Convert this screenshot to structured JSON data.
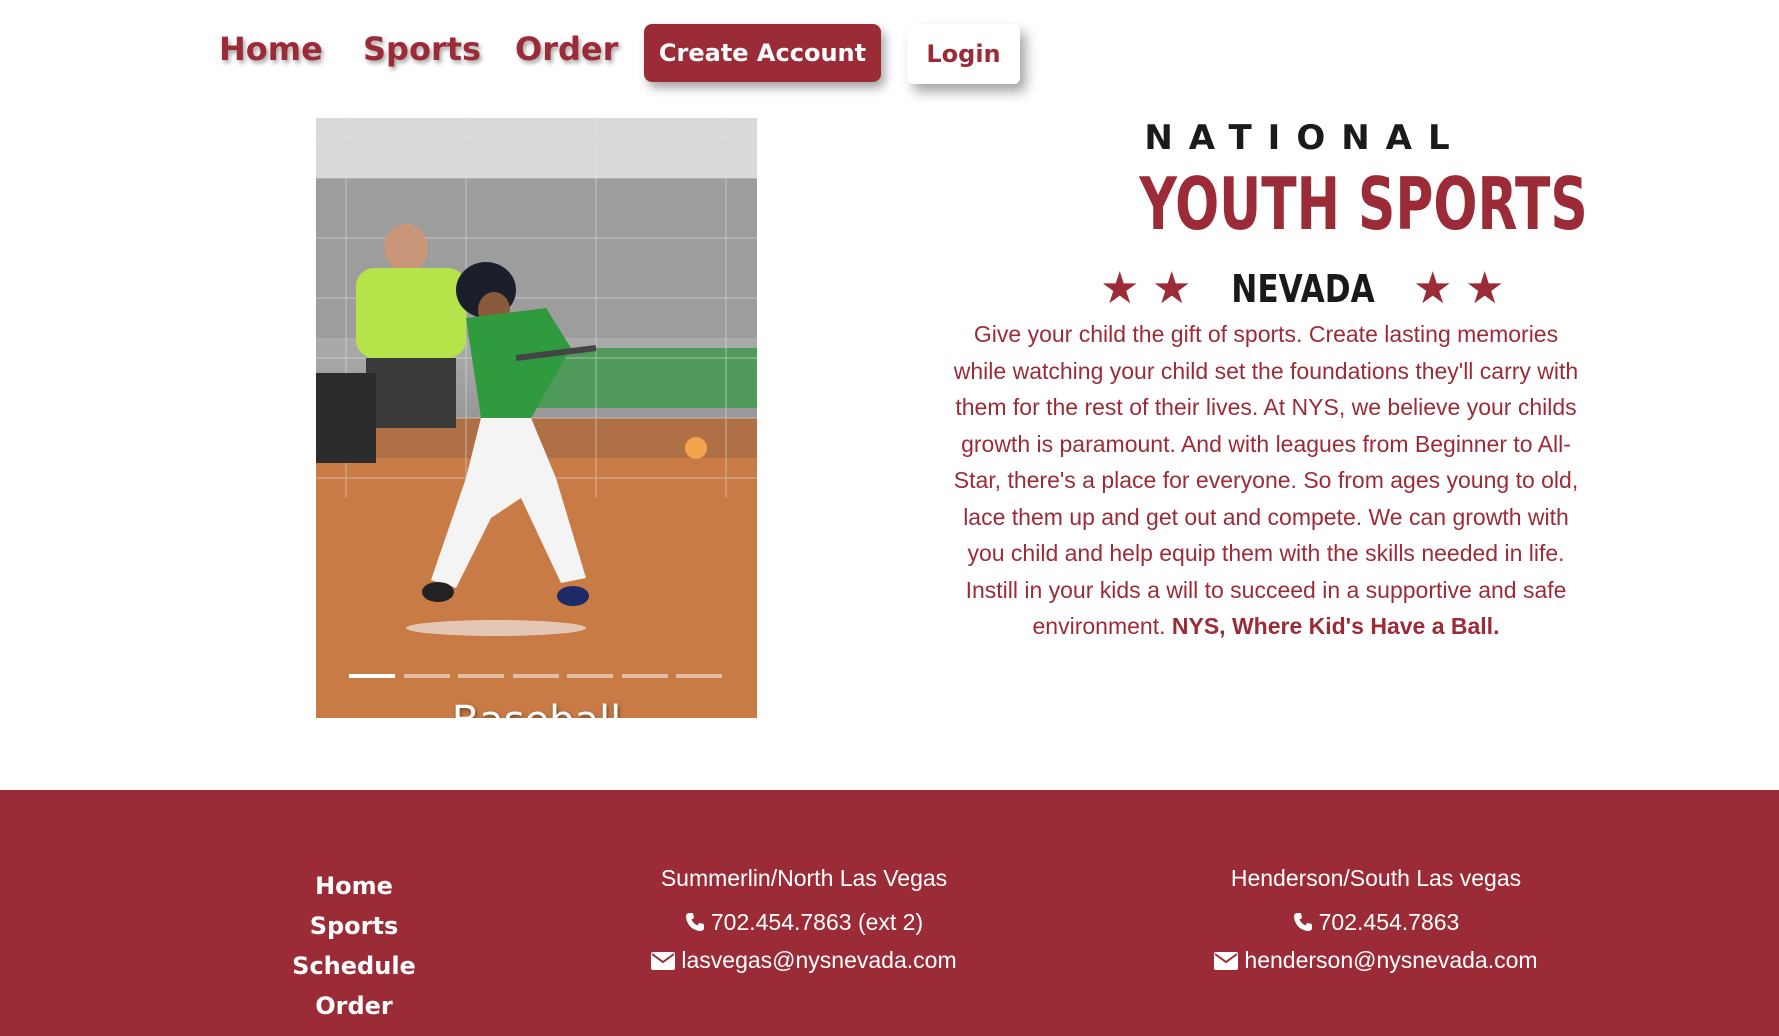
{
  "nav": {
    "home": "Home",
    "sports": "Sports",
    "order": "Order",
    "create_account": "Create Account",
    "login": "Login"
  },
  "carousel": {
    "caption": "Baseball",
    "slide_count": 7,
    "active_index": 0
  },
  "logo": {
    "line1": "NATIONAL",
    "line2": "YOUTH SPORTS",
    "line3": "NEVADA"
  },
  "intro": {
    "text": "Give your child the gift of sports. Create lasting memories while watching your child set the foundations they'll carry with them for the rest of their lives. At NYS, we believe your childs growth is paramount. And with leagues from Beginner to All-Star, there's a place for everyone. So from ages young to old, lace them up and get out and compete. We can growth with you child and help equip them with the skills needed in life. Instill in your kids a will to succeed in a supportive and safe environment.",
    "tagline": "NYS, Where Kid's Have a Ball."
  },
  "footer": {
    "links": [
      "Home",
      "Sports",
      "Schedule",
      "Order"
    ],
    "offices": [
      {
        "title": "Summerlin/North Las Vegas",
        "phone": "702.454.7863 (ext 2)",
        "email": "lasvegas@nysnevada.com"
      },
      {
        "title": "Henderson/South Las vegas",
        "phone": "702.454.7863",
        "email": "henderson@nysnevada.com"
      }
    ]
  },
  "colors": {
    "brand": "#9b2c37",
    "background": "#ffffff",
    "footer_text": "#ffffff"
  },
  "icons": {
    "phone": "phone-icon",
    "email": "envelope-icon"
  }
}
